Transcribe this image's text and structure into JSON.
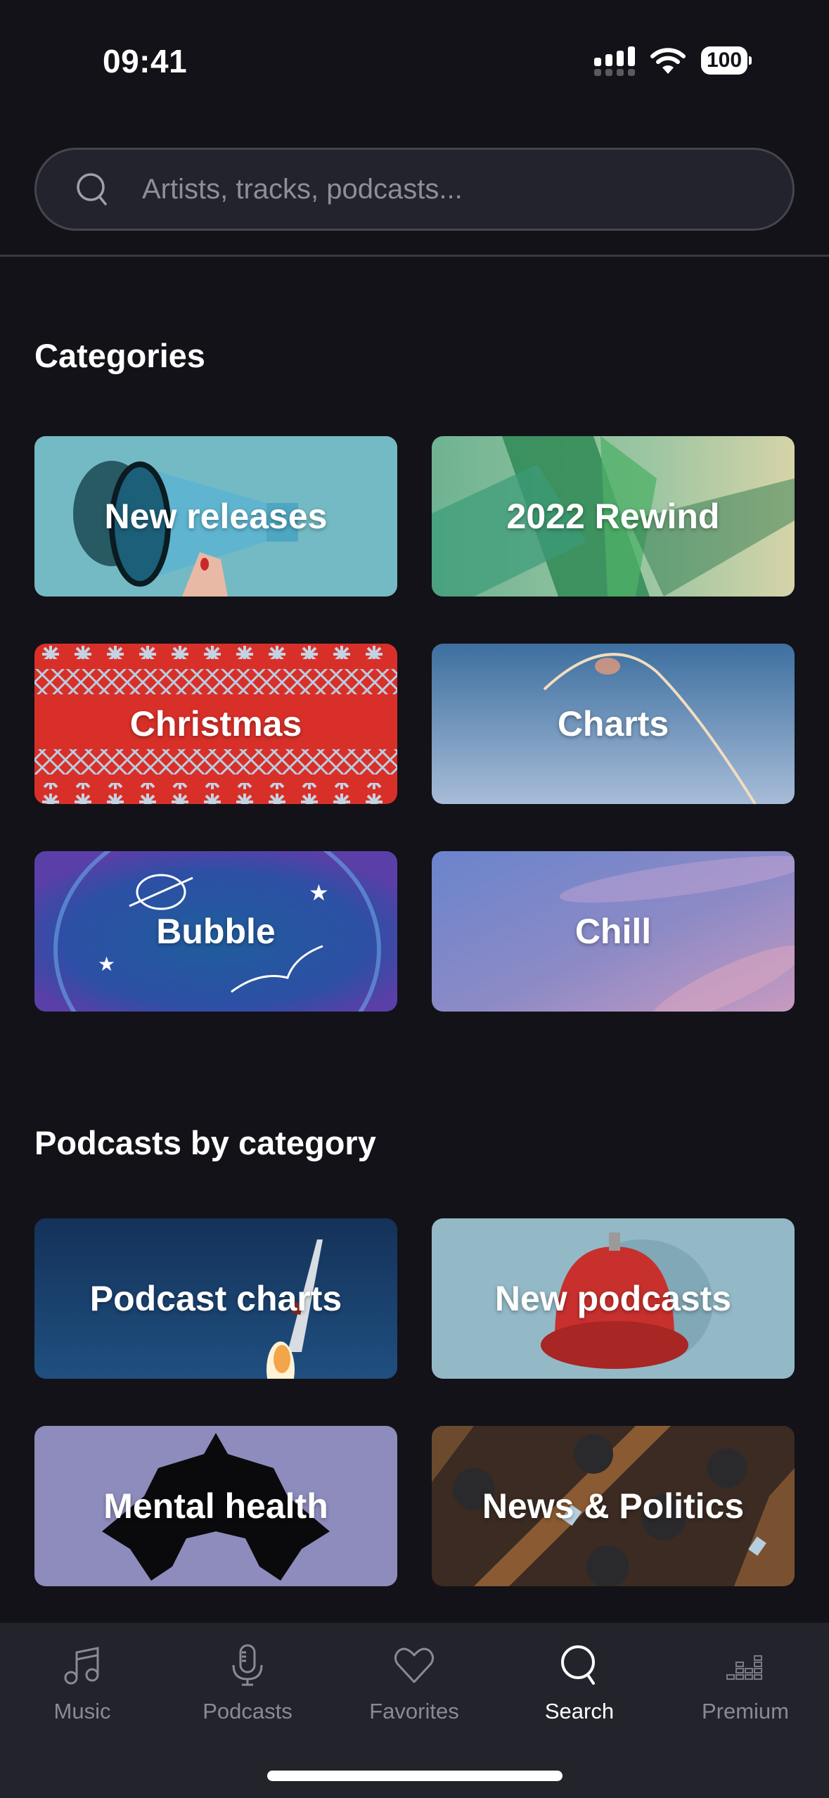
{
  "status_bar": {
    "time": "09:41",
    "battery": "100"
  },
  "search": {
    "placeholder": "Artists, tracks, podcasts...",
    "value": ""
  },
  "sections": {
    "categories": {
      "title": "Categories",
      "tiles": [
        {
          "label": "New releases",
          "theme": "megaphone",
          "color": "#73b9c4"
        },
        {
          "label": "2022 Rewind",
          "theme": "crystal",
          "color": "#5fa277"
        },
        {
          "label": "Christmas",
          "theme": "knit-sweater",
          "color": "#d8322d"
        },
        {
          "label": "Charts",
          "theme": "rocket-trail",
          "color": "#4f7fae"
        },
        {
          "label": "Bubble",
          "theme": "space-bubble",
          "color": "#2d52a0"
        },
        {
          "label": "Chill",
          "theme": "pastel-sky",
          "color": "#8b8ac8"
        }
      ]
    },
    "podcasts": {
      "title": "Podcasts by category",
      "tiles": [
        {
          "label": "Podcast charts",
          "theme": "rocket-launch",
          "color": "#1a3d66"
        },
        {
          "label": "New podcasts",
          "theme": "service-bell",
          "color": "#92b8c6"
        },
        {
          "label": "Mental health",
          "theme": "inkblot",
          "color": "#8d8cbd"
        },
        {
          "label": "News & Politics",
          "theme": "parliament",
          "color": "#3a2a20"
        }
      ]
    }
  },
  "tabbar": {
    "active": "Search",
    "tabs": [
      {
        "label": "Music",
        "icon": "music-note-icon"
      },
      {
        "label": "Podcasts",
        "icon": "microphone-icon"
      },
      {
        "label": "Favorites",
        "icon": "heart-icon"
      },
      {
        "label": "Search",
        "icon": "search-icon"
      },
      {
        "label": "Premium",
        "icon": "equalizer-icon"
      }
    ]
  }
}
